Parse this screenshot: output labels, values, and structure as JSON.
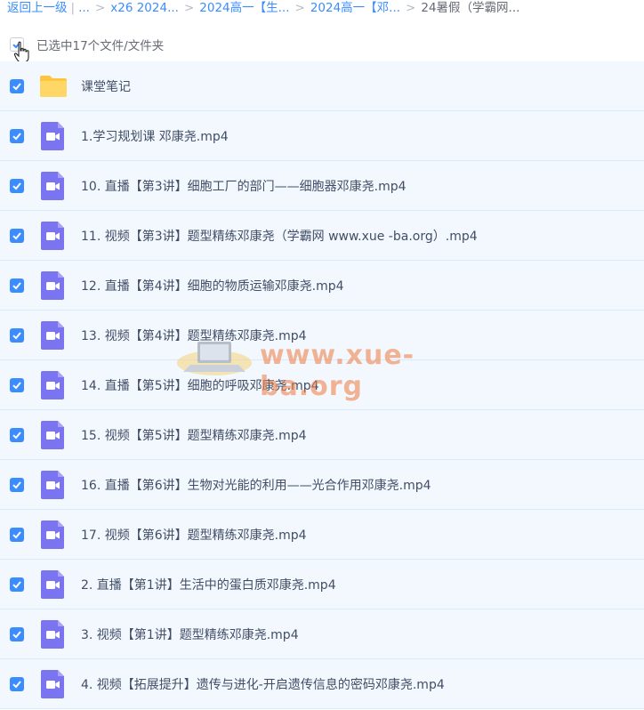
{
  "breadcrumb": {
    "back_label": "返回上一级",
    "ellipsis": "...",
    "items": [
      "x26 2024...",
      "2024高一【生...",
      "2024高一【邓...",
      "24暑假（学霸网..."
    ]
  },
  "selection": {
    "label": "已选中17个文件/文件夹"
  },
  "files": [
    {
      "name": "课堂笔记",
      "type": "folder"
    },
    {
      "name": "1.学习规划课 邓康尧.mp4",
      "type": "video"
    },
    {
      "name": "10. 直播【第3讲】细胞工厂的部门——细胞器邓康尧.mp4",
      "type": "video"
    },
    {
      "name": "11. 视频【第3讲】题型精练邓康尧（学霸网 www.xue -ba.org）.mp4",
      "type": "video"
    },
    {
      "name": "12. 直播【第4讲】细胞的物质运输邓康尧.mp4",
      "type": "video"
    },
    {
      "name": "13. 视频【第4讲】题型精练邓康尧.mp4",
      "type": "video"
    },
    {
      "name": "14. 直播【第5讲】细胞的呼吸邓康尧.mp4",
      "type": "video"
    },
    {
      "name": "15. 视频【第5讲】题型精练邓康尧.mp4",
      "type": "video"
    },
    {
      "name": "16. 直播【第6讲】生物对光能的利用——光合作用邓康尧.mp4",
      "type": "video"
    },
    {
      "name": "17. 视频【第6讲】题型精练邓康尧.mp4",
      "type": "video"
    },
    {
      "name": "2. 直播【第1讲】生活中的蛋白质邓康尧.mp4",
      "type": "video"
    },
    {
      "name": "3. 视频【第1讲】题型精练邓康尧.mp4",
      "type": "video"
    },
    {
      "name": "4. 视频【拓展提升】遗传与进化-开启遗传信息的密码邓康尧.mp4",
      "type": "video"
    }
  ],
  "watermark": {
    "text": "www.xue-ba.org"
  },
  "colors": {
    "accent": "#3b8cff",
    "video_icon": "#7b74f0",
    "folder_icon": "#ffc53d",
    "row_bg": "#f2f8fe"
  }
}
